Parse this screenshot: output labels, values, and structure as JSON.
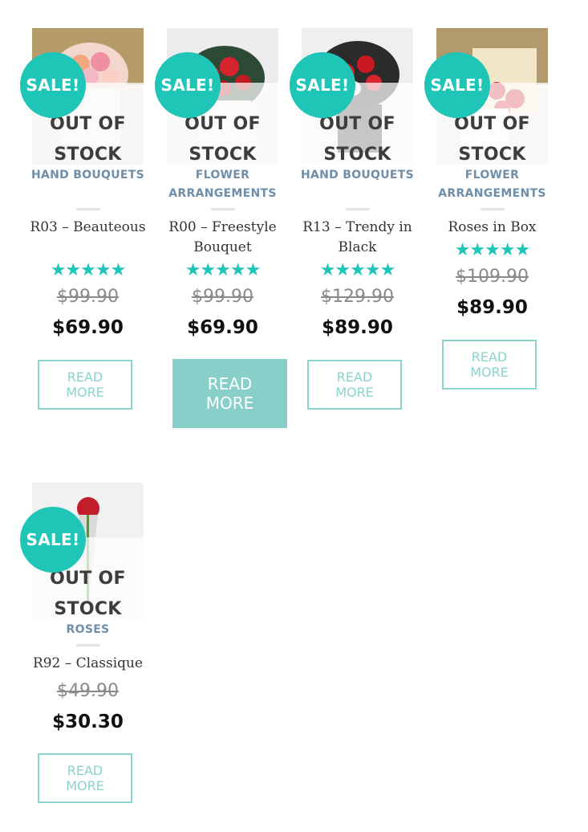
{
  "products": [
    {
      "sale": "SALE!",
      "oos": "OUT OF STOCK",
      "category": "HAND BOUQUETS",
      "title": "R03 – Beauteous",
      "stars": "★★★★★",
      "old_price": "$99.90",
      "price": "$69.90",
      "button": "READ MORE"
    },
    {
      "sale": "SALE!",
      "oos": "OUT OF STOCK",
      "category": "FLOWER ARRANGEMENTS",
      "title": "R00 – Freestyle Bouquet",
      "stars": "★★★★★",
      "old_price": "$99.90",
      "price": "$69.90",
      "button": "READ MORE"
    },
    {
      "sale": "SALE!",
      "oos": "OUT OF STOCK",
      "category": "HAND BOUQUETS",
      "title": "R13 – Trendy in Black",
      "stars": "★★★★★",
      "old_price": "$129.90",
      "price": "$89.90",
      "button": "READ MORE"
    },
    {
      "sale": "SALE!",
      "oos": "OUT OF STOCK",
      "category": "FLOWER ARRANGEMENTS",
      "title": "Roses in Box",
      "stars": "★★★★★",
      "old_price": "$109.90",
      "price": "$89.90",
      "button": "READ MORE"
    },
    {
      "sale": "SALE!",
      "oos": "OUT OF STOCK",
      "category": "ROSES",
      "title": "R92 – Classique",
      "old_price": "$49.90",
      "price": "$30.30",
      "button": "READ MORE"
    }
  ],
  "colors": {
    "accent": "#1fc6b8",
    "button_border": "#8ad3cb",
    "category": "#6f8ea8"
  }
}
